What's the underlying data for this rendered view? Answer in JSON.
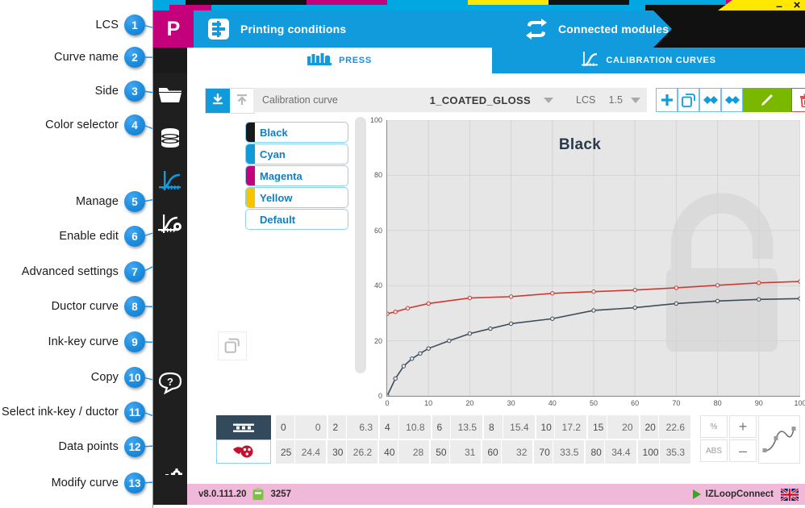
{
  "window": {
    "minimize_label": "–",
    "close_label": "×",
    "cmyk_strip": [
      "#00a7e1",
      "#c4007a",
      "#ffe800",
      "#111111"
    ]
  },
  "header": {
    "logo_letter": "P",
    "items": [
      {
        "icon": "printing-conditions-icon",
        "label": "Printing conditions"
      },
      {
        "icon": "connected-modules-icon",
        "label": "Connected modules"
      }
    ]
  },
  "tabs": [
    {
      "icon": "press-icon",
      "label": "PRESS",
      "active": false
    },
    {
      "icon": "calibration-curves-icon",
      "label": "CALIBRATION CURVES",
      "active": true
    }
  ],
  "rail": {
    "items": [
      {
        "icon": "folder-icon",
        "name": "jobs"
      },
      {
        "icon": "database-icon",
        "name": "database"
      },
      {
        "icon": "curve-icon",
        "name": "calibration-curves"
      },
      {
        "icon": "curve-settings-icon",
        "name": "curve-settings"
      },
      {
        "icon": "help-icon",
        "name": "help"
      },
      {
        "icon": "gears-icon",
        "name": "settings"
      }
    ]
  },
  "toolbar": {
    "side_down_icon": "arrow-down-to-line-icon",
    "side_up_icon": "arrow-up-to-line-icon",
    "curve_label": "Calibration curve",
    "curve_value": "1_COATED_GLOSS",
    "lcs_label": "LCS",
    "lcs_value": "1.5",
    "buttons": [
      {
        "name": "add-curve-button",
        "icon": "plus-icon"
      },
      {
        "name": "copy-curve-button",
        "icon": "copy-icon"
      },
      {
        "name": "import-curve-button",
        "icon": "import-icon"
      },
      {
        "name": "export-curve-button",
        "icon": "export-icon"
      },
      {
        "name": "enable-edit-button",
        "icon": "pencil-icon"
      },
      {
        "name": "delete-curve-button",
        "icon": "trash-icon"
      },
      {
        "name": "advanced-settings-button",
        "icon": "wrench-icon"
      }
    ]
  },
  "color_selector": {
    "items": [
      {
        "label": "Black",
        "color": "#1a1a1a",
        "selected": true
      },
      {
        "label": "Cyan",
        "color": "#0f9bd8",
        "selected": false
      },
      {
        "label": "Magenta",
        "color": "#c4007a",
        "selected": false
      },
      {
        "label": "Yellow",
        "color": "#f6c500",
        "selected": false
      },
      {
        "label": "Default",
        "color": "#ffffff",
        "selected": false
      }
    ]
  },
  "chart_data": {
    "type": "line",
    "title": "Black",
    "xlabel": "",
    "ylabel": "",
    "xlim": [
      0,
      100
    ],
    "ylim": [
      0,
      100
    ],
    "xticks": [
      0,
      10,
      20,
      30,
      40,
      50,
      60,
      70,
      80,
      90,
      100
    ],
    "yticks": [
      0,
      20,
      40,
      60,
      80,
      100
    ],
    "grid": true,
    "legend": "none",
    "series": [
      {
        "name": "Ink-key curve",
        "color": "#3e4d59",
        "x": [
          0,
          2,
          4,
          6,
          8,
          10,
          15,
          20,
          25,
          30,
          40,
          50,
          60,
          70,
          80,
          90,
          100
        ],
        "y": [
          0,
          6.3,
          10.8,
          13.5,
          15.4,
          17.2,
          20,
          22.6,
          24.4,
          26.2,
          28,
          31,
          32,
          33.5,
          34.4,
          35,
          35.3
        ]
      },
      {
        "name": "Ductor curve",
        "color": "#cc3b33",
        "x": [
          0,
          2,
          5,
          10,
          20,
          30,
          40,
          50,
          60,
          70,
          80,
          90,
          100
        ],
        "y": [
          29.8,
          30.5,
          31.8,
          33.5,
          35.5,
          36.0,
          37.2,
          37.8,
          38.4,
          39.2,
          40.1,
          41.0,
          41.5
        ]
      }
    ]
  },
  "copy_button": {
    "name": "copy-button",
    "icon": "copy-icon"
  },
  "select_buttons": [
    {
      "name": "select-ink-key-button",
      "icon": "ink-key-icon",
      "active": true
    },
    {
      "name": "select-ductor-button",
      "icon": "ductor-icon",
      "active": false
    }
  ],
  "data_table": {
    "row1": [
      {
        "x": "0",
        "y": "0"
      },
      {
        "x": "2",
        "y": "6.3"
      },
      {
        "x": "4",
        "y": "10.8"
      },
      {
        "x": "6",
        "y": "13.5"
      },
      {
        "x": "8",
        "y": "15.4"
      },
      {
        "x": "10",
        "y": "17.2"
      },
      {
        "x": "15",
        "y": "20"
      },
      {
        "x": "20",
        "y": "22.6"
      }
    ],
    "row2": [
      {
        "x": "25",
        "y": "24.4"
      },
      {
        "x": "30",
        "y": "26.2"
      },
      {
        "x": "40",
        "y": "28"
      },
      {
        "x": "50",
        "y": "31"
      },
      {
        "x": "60",
        "y": "32"
      },
      {
        "x": "70",
        "y": "33.5"
      },
      {
        "x": "80",
        "y": "34.4"
      },
      {
        "x": "100",
        "y": "35.3"
      }
    ]
  },
  "modify_panel": {
    "percent_label": "%",
    "abs_label": "ABS",
    "plus_label": "+",
    "minus_label": "–",
    "curve_icon": "modify-curve-icon"
  },
  "status_bar": {
    "version": "v8.0.111.20",
    "dongle_icon": "usb-dongle-icon",
    "dongle_count": "3257",
    "connect_label": "IZLoopConnect",
    "play_icon": "play-icon",
    "language_icon": "uk-flag-icon",
    "background": "#f0b9d9"
  },
  "annotations": [
    {
      "n": "1",
      "label": "LCS"
    },
    {
      "n": "2",
      "label": "Curve name"
    },
    {
      "n": "3",
      "label": "Side"
    },
    {
      "n": "4",
      "label": "Color selector"
    },
    {
      "n": "5",
      "label": "Manage"
    },
    {
      "n": "6",
      "label": "Enable edit"
    },
    {
      "n": "7",
      "label": "Advanced settings"
    },
    {
      "n": "8",
      "label": "Ductor curve"
    },
    {
      "n": "9",
      "label": "Ink-key curve"
    },
    {
      "n": "10",
      "label": "Copy"
    },
    {
      "n": "11",
      "label": "Select ink-key / ductor"
    },
    {
      "n": "12",
      "label": "Data points"
    },
    {
      "n": "13",
      "label": "Modify curve"
    }
  ]
}
